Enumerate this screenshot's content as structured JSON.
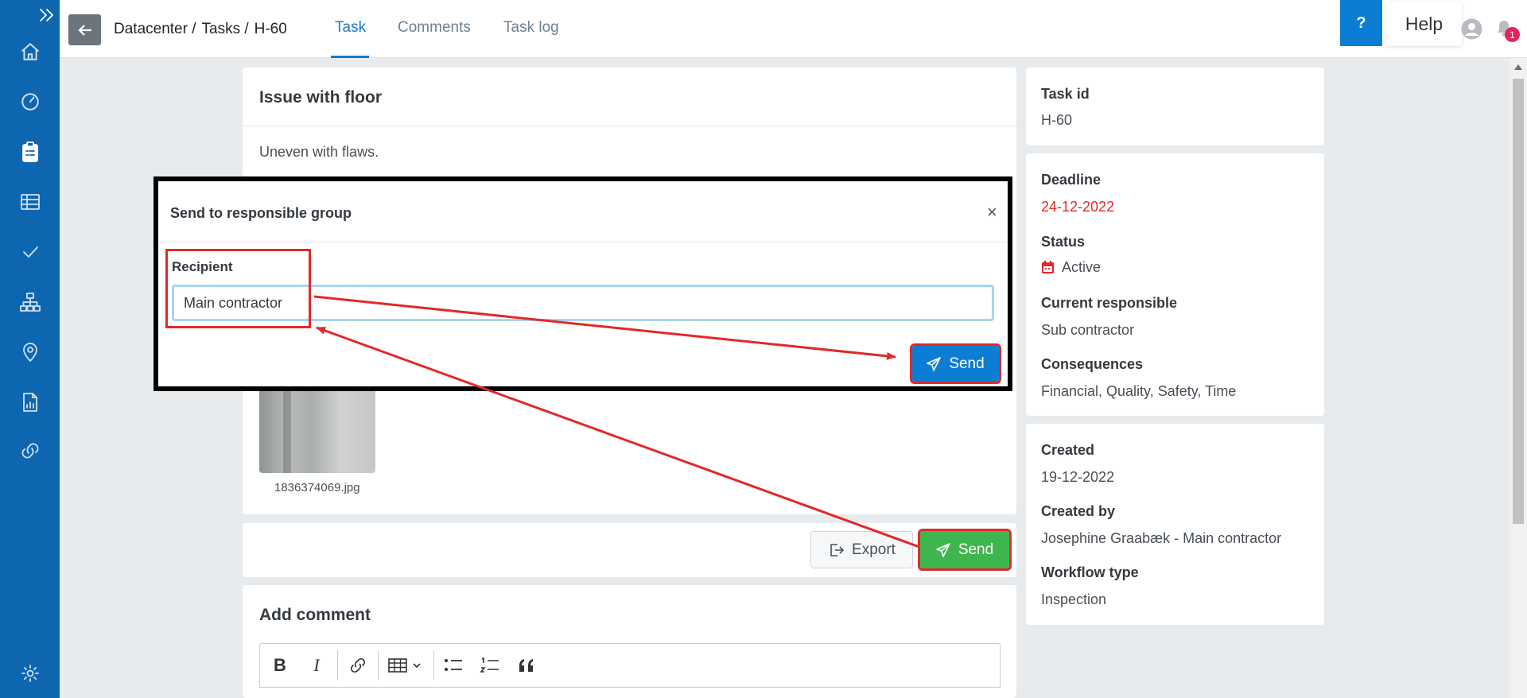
{
  "sidebar": {
    "items": [
      {
        "icon": "home-icon"
      },
      {
        "icon": "dashboard-icon"
      },
      {
        "icon": "tasks-icon",
        "active": true
      },
      {
        "icon": "table-icon"
      },
      {
        "icon": "check-icon"
      },
      {
        "icon": "org-chart-icon"
      },
      {
        "icon": "location-icon"
      },
      {
        "icon": "report-icon"
      },
      {
        "icon": "link-icon"
      }
    ],
    "settings_icon": "gear-icon"
  },
  "header": {
    "breadcrumb": [
      "Datacenter /",
      "Tasks /",
      "H-60"
    ],
    "tabs": [
      {
        "label": "Task",
        "active": true
      },
      {
        "label": "Comments"
      },
      {
        "label": "Task log"
      }
    ],
    "help_q": "?",
    "help_label": "Help",
    "notification_count": "1"
  },
  "task": {
    "title": "Issue with floor",
    "description": "Uneven with flaws.",
    "attachment_name": "1836374069.jpg",
    "export_label": "Export",
    "send_label": "Send"
  },
  "comment": {
    "title": "Add comment",
    "toolbar": [
      "B",
      "I"
    ]
  },
  "details": {
    "task_id_label": "Task id",
    "task_id": "H-60",
    "deadline_label": "Deadline",
    "deadline": "24-12-2022",
    "status_label": "Status",
    "status": "Active",
    "current_responsible_label": "Current responsible",
    "current_responsible": "Sub contractor",
    "consequences_label": "Consequences",
    "consequences": "Financial, Quality, Safety, Time",
    "created_label": "Created",
    "created": "19-12-2022",
    "created_by_label": "Created by",
    "created_by": "Josephine Graabæk - Main contractor",
    "workflow_type_label": "Workflow type",
    "workflow_type": "Inspection"
  },
  "modal": {
    "title": "Send to responsible group",
    "close": "×",
    "recipient_label": "Recipient",
    "recipient_value": "Main contractor",
    "send_label": "Send"
  },
  "colors": {
    "sidebar": "#0f66b0",
    "accent": "#1a7ac7",
    "send_green": "#3fb54d",
    "send_blue": "#0b7ed3",
    "deadline": "#e02a2a",
    "annotation": "#e02a2a"
  }
}
